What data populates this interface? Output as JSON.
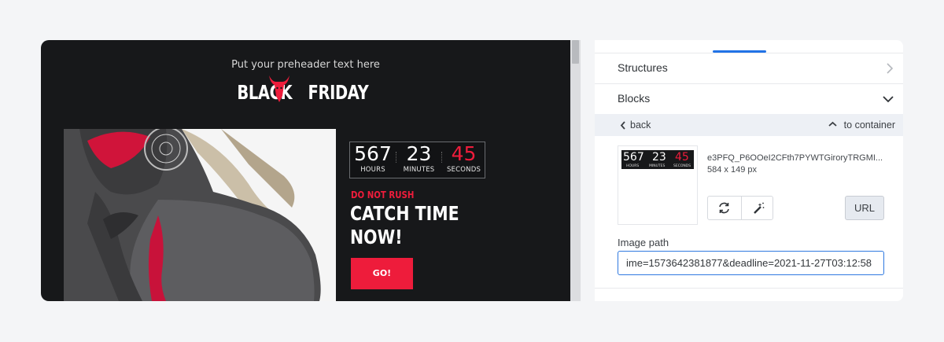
{
  "email_preview": {
    "preheader": "Put your preheader text here",
    "logo": {
      "left": "BLACK",
      "right": "FRIDAY"
    },
    "countdown": {
      "hours": {
        "value": "567",
        "label": "HOURS"
      },
      "minutes": {
        "value": "23",
        "label": "MINUTES"
      },
      "seconds": {
        "value": "45",
        "label": "SECONDS"
      }
    },
    "subheading": "DO NOT RUSH",
    "headline_line1": "CATCH TIME",
    "headline_line2": "NOW!",
    "cta_label": "GO!",
    "colors": {
      "background": "#17181a",
      "accent": "#ee1c3b"
    }
  },
  "panel": {
    "structures_label": "Structures",
    "blocks_label": "Blocks",
    "back_label": "back",
    "to_container_label": "to container",
    "image": {
      "filename": "e3PFQ_P6OOeI2CFth7PYWTGiroryTRGMI...",
      "dimensions": "584 x 149 px",
      "url_button": "URL",
      "refresh_icon": "refresh-icon",
      "magic_icon": "magic-wand-icon"
    },
    "image_path_label": "Image path",
    "image_path_value": "ime=1573642381877&deadline=2021-11-27T03:12:58",
    "colors": {
      "tab_indicator": "#2173e6",
      "input_border": "#2f79e0"
    }
  }
}
